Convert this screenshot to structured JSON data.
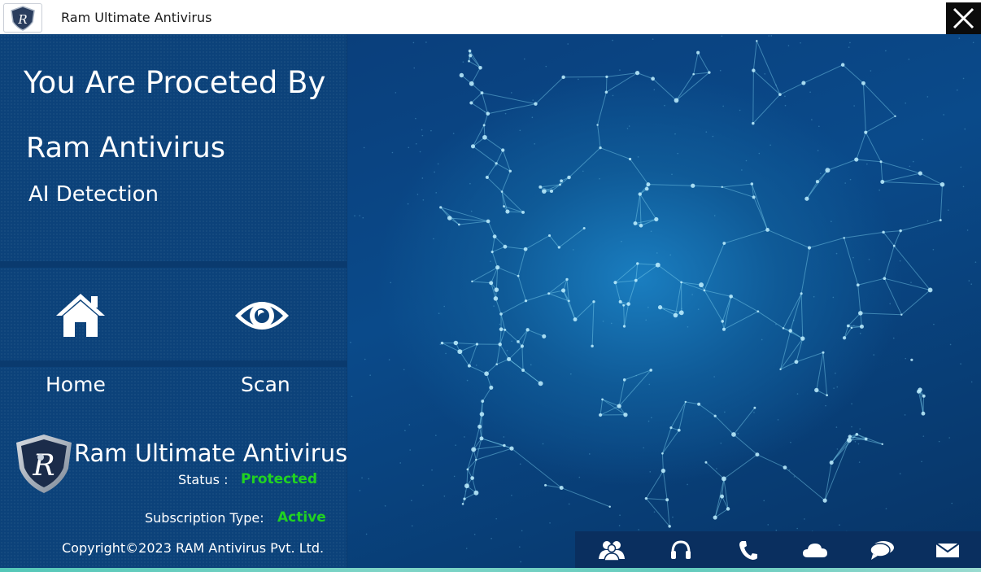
{
  "window": {
    "title": "Ram Ultimate Antivirus",
    "close_icon": "close-icon"
  },
  "hero": {
    "headline": "You Are Proceted By",
    "brand": "Ram Antivirus",
    "tagline": "AI Detection"
  },
  "nav": {
    "home": {
      "label": "Home",
      "icon": "home-icon"
    },
    "scan": {
      "label": "Scan",
      "icon": "eye-icon"
    }
  },
  "footer": {
    "product_name": "Ram Ultimate Antivirus",
    "status_label": "Status :",
    "status_value": "Protected",
    "subscription_label": "Subscription Type:",
    "subscription_value": "Active",
    "copyright": "Copyright©2023 RAM Antivirus Pvt. Ltd."
  },
  "bottom_bar": {
    "icons": [
      "community-icon",
      "headset-icon",
      "phone-icon",
      "cloud-icon",
      "chat-icon",
      "mail-icon"
    ]
  },
  "colors": {
    "panel_bg": "#0c427a",
    "status_green": "#21d221",
    "bar_bg": "#0a2f5f"
  }
}
